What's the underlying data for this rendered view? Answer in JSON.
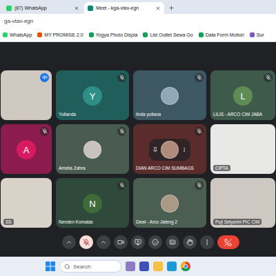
{
  "browser": {
    "tabs": [
      {
        "label": "(87) WhatsApp",
        "selected": false,
        "color": "#25d366"
      },
      {
        "label": "Meet - kga-vtav-egn",
        "selected": true,
        "color": "#00897b"
      }
    ],
    "address": "ga-vtav-egn",
    "bookmarks": [
      {
        "label": "WhatsApp",
        "color": "#25d366"
      },
      {
        "label": "MY PROMISE 2.0",
        "color": "#e65100"
      },
      {
        "label": "Yogya Photo Displa",
        "color": "#0f9d58"
      },
      {
        "label": "List Outlet Sewa Go",
        "color": "#0f9d58"
      },
      {
        "label": "Data Form Moitori",
        "color": "#0f9d58"
      },
      {
        "label": "Sur",
        "color": "#7e57c2"
      }
    ]
  },
  "participants": [
    {
      "name": "",
      "kind": "video",
      "initial": "",
      "color": "#cfc9c2",
      "avatar_color": "",
      "muted": false,
      "speaking": true,
      "pinned": false
    },
    {
      "name": "Yulianda",
      "kind": "initial",
      "initial": "Y",
      "color": "#1f5e5b",
      "avatar_color": "#2f8e88",
      "muted": true,
      "speaking": false,
      "pinned": false
    },
    {
      "name": "linda yuliana",
      "kind": "avatar",
      "initial": "",
      "color": "#3d5862",
      "avatar_color": "#8fa9b8",
      "muted": true,
      "speaking": false,
      "pinned": false
    },
    {
      "name": "LILIS - ARCO CIM JABA",
      "kind": "initial",
      "initial": "L",
      "color": "#3e5a4a",
      "avatar_color": "#5f8b55",
      "muted": true,
      "speaking": false,
      "pinned": false
    },
    {
      "name": "",
      "kind": "initial",
      "initial": "A",
      "color": "#8c1b4e",
      "avatar_color": "#d81b60",
      "muted": true,
      "speaking": false,
      "pinned": false
    },
    {
      "name": "Amelia Zahra",
      "kind": "avatar",
      "initial": "",
      "color": "#4a5b52",
      "avatar_color": "#c7c2bb",
      "muted": true,
      "speaking": false,
      "pinned": false
    },
    {
      "name": "DIAN ARCO CIM SUMBAGS",
      "kind": "avatar",
      "initial": "",
      "color": "#5a2c2c",
      "avatar_color": "#b08a7a",
      "muted": true,
      "speaking": false,
      "pinned": true
    },
    {
      "name": "CIPTA",
      "kind": "video",
      "initial": "",
      "color": "#e8e8e6",
      "avatar_color": "",
      "muted": false,
      "speaking": false,
      "pinned": false
    },
    {
      "name": "SS",
      "kind": "video",
      "initial": "",
      "color": "#d8d2c9",
      "avatar_color": "",
      "muted": false,
      "speaking": false,
      "pinned": false
    },
    {
      "name": "Nenden Komalas",
      "kind": "initial",
      "initial": "N",
      "color": "#2f4a3b",
      "avatar_color": "#3f6b3a",
      "muted": true,
      "speaking": false,
      "pinned": false
    },
    {
      "name": "Dewi - Arco Jateng 2",
      "kind": "avatar",
      "initial": "",
      "color": "#4b5e52",
      "avatar_color": "#a99a86",
      "muted": true,
      "speaking": false,
      "pinned": false
    },
    {
      "name": "Puji Setyorini PIC CIM",
      "kind": "video",
      "initial": "",
      "color": "#cdc8c1",
      "avatar_color": "",
      "muted": false,
      "speaking": false,
      "pinned": false
    }
  ],
  "controls": {
    "microphone": {
      "muted": true
    },
    "camera": {
      "off": false
    }
  },
  "taskbar": {
    "search": {
      "placeholder": "Search"
    }
  }
}
